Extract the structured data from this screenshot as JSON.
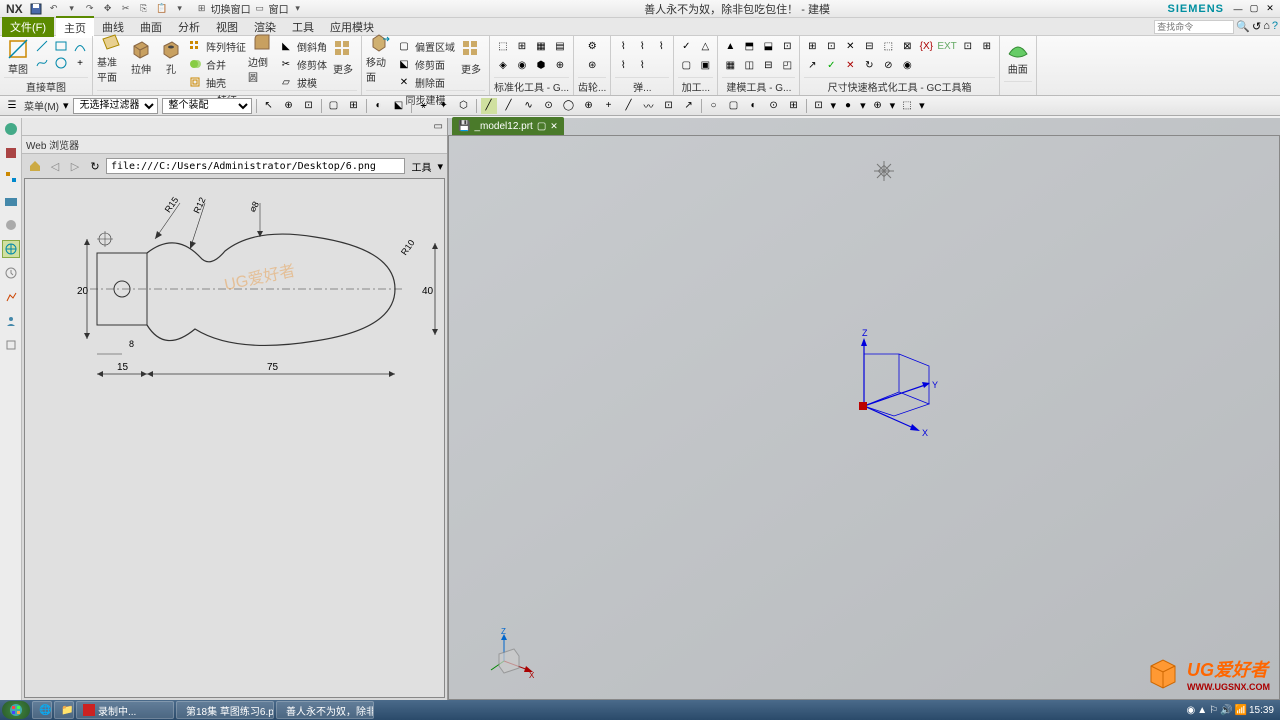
{
  "title_bar": {
    "app": "NX",
    "window_switch": "切换窗口",
    "window_menu": "窗口",
    "title": "善人永不为奴，除非包吃包住！ - 建模",
    "brand": "SIEMENS"
  },
  "menu": {
    "file": "文件(F)",
    "tabs": [
      "主页",
      "曲线",
      "曲面",
      "分析",
      "视图",
      "渲染",
      "工具",
      "应用模块"
    ],
    "active_tab_index": 0,
    "search_placeholder": "查找命令"
  },
  "ribbon": {
    "groups": {
      "sketch": {
        "label": "直接草图",
        "main": "草图"
      },
      "feature": {
        "label": "特征",
        "items": {
          "datum": "基准平面",
          "extrude": "拉伸",
          "hole": "孔"
        },
        "side": {
          "pattern": "阵列特征",
          "unite": "合并",
          "shell": "抽壳"
        },
        "side2": {
          "edge_blend": "边倒圆",
          "trim": "修剪体",
          "draft": "拔模"
        },
        "more": "更多"
      },
      "sync": {
        "label": "同步建模",
        "main": "移动面",
        "side": {
          "edit": "偏置区域",
          "replace": "修剪面",
          "delete": "删除面"
        },
        "more": "更多"
      },
      "std": {
        "label": "标准化工具 - G..."
      },
      "gear": {
        "label": "齿轮..."
      },
      "spring": {
        "label": "弹..."
      },
      "machining": {
        "label": "加工..."
      },
      "modeling": {
        "label": "建模工具 - G..."
      },
      "dim_express": {
        "label": "尺寸快速格式化工具 - GC工具箱"
      },
      "surface": {
        "label": "",
        "main": "曲面"
      }
    }
  },
  "sel_bar": {
    "menu_btn": "菜单(M)",
    "filter": "无选择过滤器",
    "assembly": "整个装配"
  },
  "web_panel": {
    "title": "Web 浏览器",
    "url": "file:///C:/Users/Administrator/Desktop/6.png",
    "tools": "工具"
  },
  "canvas": {
    "tab_name": "_model12.prt",
    "tab_icon": "✓",
    "axes": {
      "x": "X",
      "y": "Y",
      "z": "Z"
    }
  },
  "drawing": {
    "dims": {
      "h": "20",
      "base_w": "8",
      "left_w": "15",
      "total_w": "75",
      "r15": "R15",
      "r12": "R12",
      "d8": "⌀8",
      "r10": "R10",
      "right_h": "40"
    },
    "watermark": "UG爱好者"
  },
  "watermark": {
    "main": "UG爱好者",
    "sub": "WWW.UGSNX.COM"
  },
  "taskbar": {
    "items": [
      {
        "label": "录制中..."
      },
      {
        "label": "第18集 草图练习6.p..."
      },
      {
        "label": "善人永不为奴，除非..."
      }
    ],
    "time": "15:39"
  }
}
